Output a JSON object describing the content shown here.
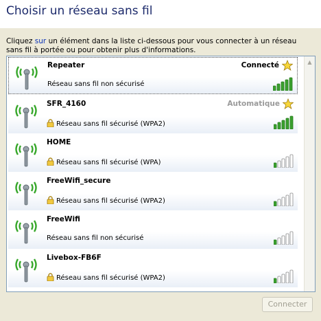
{
  "title": "Choisir un réseau sans fil",
  "description": {
    "before_link": "Cliquez ",
    "link": "sur",
    "after_link": " un élément dans la liste ci-dessous pour vous connecter à un réseau sans fil à portée ou pour obtenir plus d'informations."
  },
  "networks": [
    {
      "name": "Repeater",
      "status": "Connecté",
      "security": "Réseau sans fil non sécurisé",
      "secured": false,
      "signal_bars": 5,
      "starred": true,
      "selected": true
    },
    {
      "name": "SFR_4160",
      "status": "Automatique",
      "security": "Réseau sans fil sécurisé (WPA2)",
      "secured": true,
      "signal_bars": 5,
      "starred": true,
      "selected": false
    },
    {
      "name": "HOME",
      "status": "",
      "security": "Réseau sans fil sécurisé (WPA)",
      "secured": true,
      "signal_bars": 1,
      "starred": false,
      "selected": false
    },
    {
      "name": "FreeWifi_secure",
      "status": "",
      "security": "Réseau sans fil sécurisé (WPA2)",
      "secured": true,
      "signal_bars": 1,
      "starred": false,
      "selected": false
    },
    {
      "name": "FreeWifi",
      "status": "",
      "security": "Réseau sans fil non sécurisé",
      "secured": false,
      "signal_bars": 1,
      "starred": false,
      "selected": false
    },
    {
      "name": "Livebox-FB6F",
      "status": "",
      "security": "Réseau sans fil sécurisé (WPA2)",
      "secured": true,
      "signal_bars": 1,
      "starred": false,
      "selected": false
    }
  ],
  "connect_button": "Connecter",
  "colors": {
    "signal_on": "#3aa02e",
    "signal_off": "#ffffff",
    "title": "#1c2a6b",
    "link": "#0b33b8"
  }
}
